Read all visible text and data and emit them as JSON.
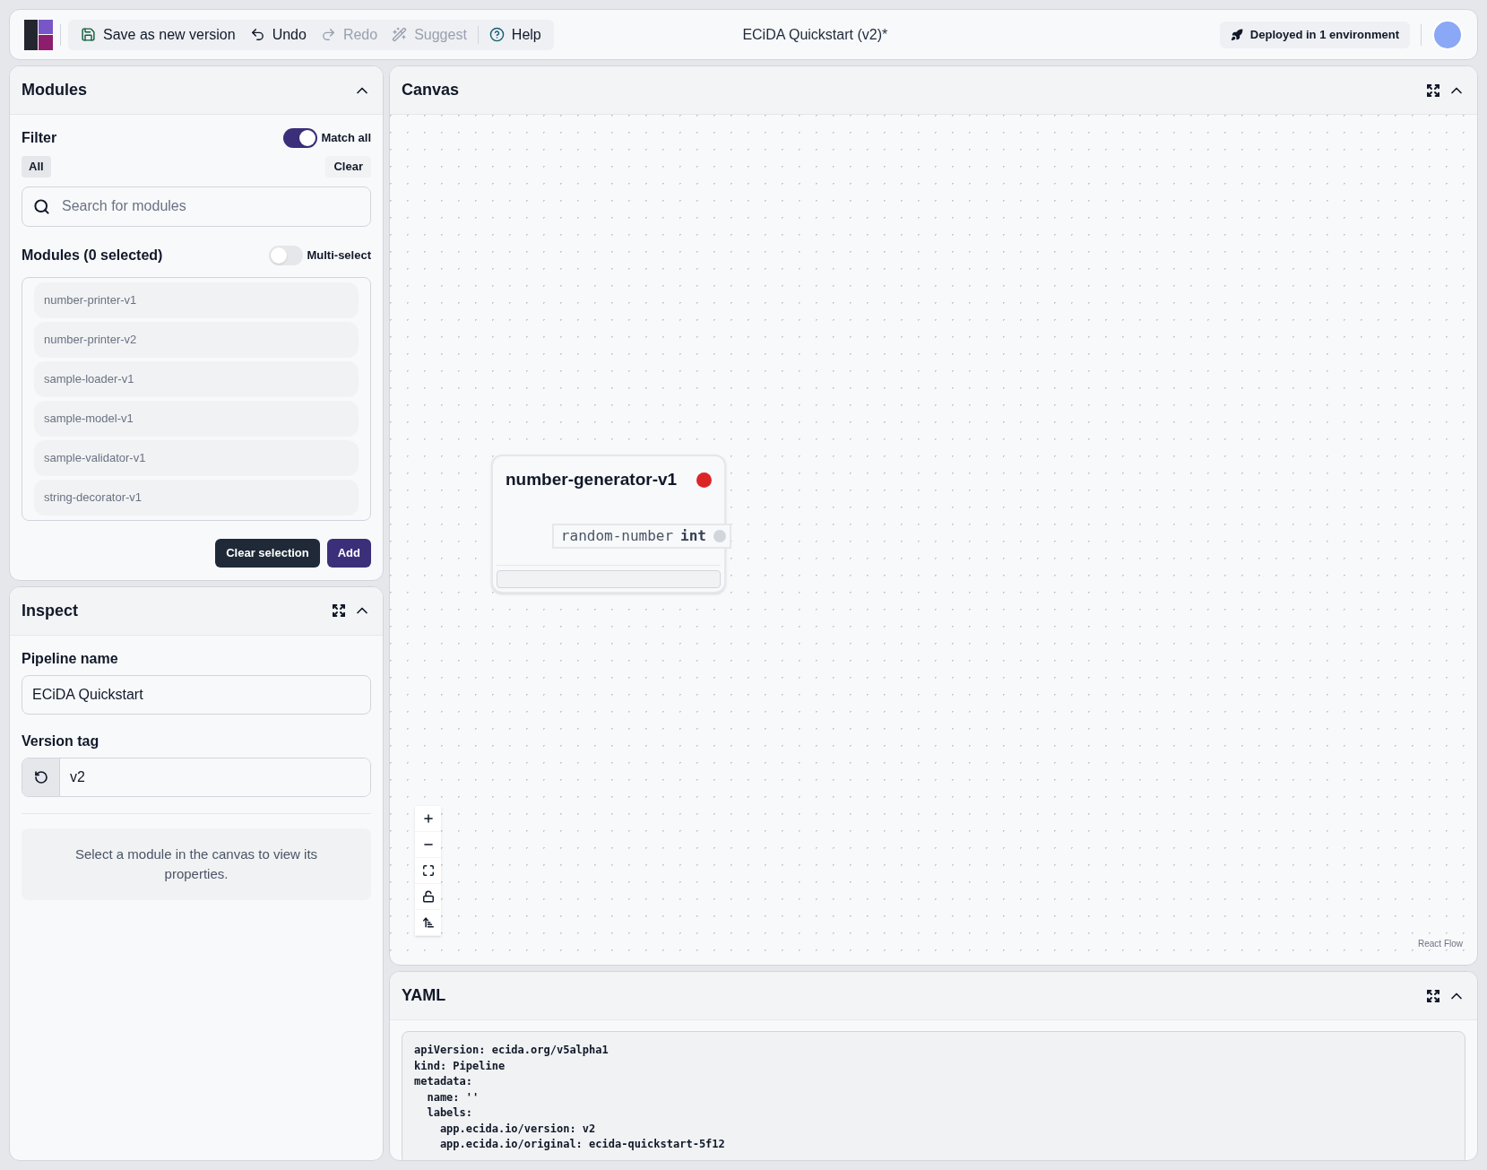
{
  "header": {
    "actions": [
      {
        "kind": "save",
        "label": "Save as new version",
        "disabled": false
      },
      {
        "kind": "undo",
        "label": "Undo",
        "disabled": false
      },
      {
        "kind": "redo",
        "label": "Redo",
        "disabled": true
      },
      {
        "kind": "suggest",
        "label": "Suggest",
        "disabled": true
      },
      {
        "kind": "help",
        "label": "Help",
        "disabled": false
      }
    ],
    "title": "ECiDA Quickstart (v2)*",
    "deployment": "Deployed in 1 environment"
  },
  "modules_panel": {
    "title": "Modules",
    "expanded": true,
    "filter_label": "Filter",
    "match_all": {
      "label": "Match all",
      "on": true
    },
    "all_chip": "All",
    "clear": "Clear",
    "search": {
      "placeholder": "Search for modules"
    },
    "list_heading": "Modules (0 selected)",
    "multi_select": {
      "label": "Multi-select",
      "on": false
    },
    "items": [
      {
        "name": "number-printer-v1",
        "selected": false
      },
      {
        "name": "number-printer-v2",
        "selected": false
      },
      {
        "name": "sample-loader-v1",
        "selected": false
      },
      {
        "name": "sample-model-v1",
        "selected": false
      },
      {
        "name": "sample-validator-v1",
        "selected": false
      },
      {
        "name": "string-decorator-v1",
        "selected": false
      }
    ],
    "buttons": [
      {
        "kind": "secondary",
        "label": "Clear selection"
      },
      {
        "kind": "primary",
        "label": "Add"
      }
    ]
  },
  "inspect_panel": {
    "title": "Inspect",
    "expanded": true,
    "pipeline_name": {
      "label": "Pipeline name",
      "value": "ECiDA Quickstart"
    },
    "version_tag": {
      "label": "Version tag",
      "value": "v2"
    },
    "hint": "Select a module in the canvas to view its properties."
  },
  "canvas_panel": {
    "title": "Canvas",
    "expanded": true,
    "node": {
      "title": "number-generator-v1",
      "color": "#dc2626",
      "output": {
        "name": "random-number",
        "type": "int"
      }
    },
    "attribution": "React Flow"
  },
  "yaml_panel": {
    "title": "YAML",
    "expanded": true,
    "lines": [
      "apiVersion: ecida.org/v5alpha1",
      "kind: Pipeline",
      "metadata:",
      "  name: ''",
      "  labels:",
      "    app.ecida.io/version: v2",
      "    app.ecida.io/original: ecida-quickstart-5f12"
    ]
  }
}
